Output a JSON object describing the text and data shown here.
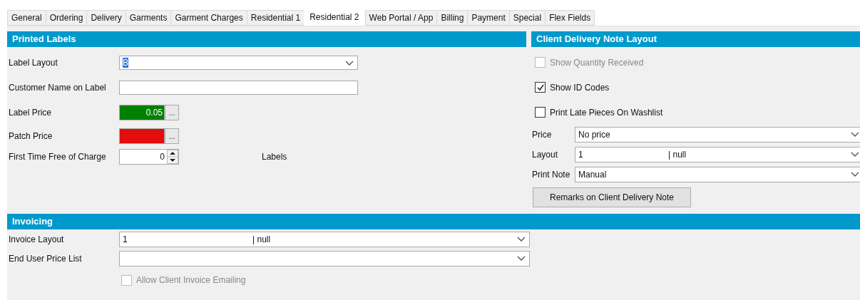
{
  "tabs": [
    {
      "label": "General",
      "selected": false
    },
    {
      "label": "Ordering",
      "selected": false
    },
    {
      "label": "Delivery",
      "selected": false
    },
    {
      "label": "Garments",
      "selected": false
    },
    {
      "label": "Garment Charges",
      "selected": false
    },
    {
      "label": "Residential 1",
      "selected": false
    },
    {
      "label": "Residential 2",
      "selected": true
    },
    {
      "label": "Web Portal / App",
      "selected": false
    },
    {
      "label": "Billing",
      "selected": false
    },
    {
      "label": "Payment",
      "selected": false
    },
    {
      "label": "Special",
      "selected": false
    },
    {
      "label": "Flex Fields",
      "selected": false
    }
  ],
  "printed_labels": {
    "title": "Printed Labels",
    "rows": [
      {
        "label": "Label Layout",
        "kind": "dropdown",
        "value": [
          "B"
        ],
        "highlighted": true
      },
      {
        "label": "Customer Name on Label",
        "kind": "text",
        "value": []
      },
      {
        "label": "Label Price",
        "kind": "price",
        "value": [
          "0.05"
        ],
        "color": "#008000",
        "button": "..."
      },
      {
        "label": "Patch Price",
        "kind": "price",
        "value": [],
        "color": "#e30d0d",
        "button": "..."
      },
      {
        "label": "First Time Free of Charge",
        "kind": "spinner",
        "value": [
          "0"
        ],
        "unit": "Labels"
      }
    ]
  },
  "client_delivery_note_layout": {
    "title": "Client Delivery Note Layout",
    "checkboxes": [
      {
        "label": "Show Quantity Received",
        "checked": false,
        "disabled": true
      },
      {
        "label": "Show ID Codes",
        "checked": true,
        "disabled": false
      },
      {
        "label": "Print Late Pieces On Washlist",
        "checked": false,
        "disabled": false
      }
    ],
    "rows": [
      {
        "label": "Price",
        "kind": "dropdown",
        "value": [
          "No price"
        ]
      },
      {
        "label": "Layout",
        "kind": "dropdown",
        "value": [
          "1",
          "| null"
        ]
      },
      {
        "label": "Print Note",
        "kind": "dropdown",
        "value": [
          "Manual"
        ]
      }
    ],
    "button": "Remarks on Client Delivery Note"
  },
  "invoicing": {
    "title": "Invoicing",
    "rows": [
      {
        "label": "Invoice Layout",
        "kind": "dropdown",
        "value": [
          "1",
          "| null"
        ]
      },
      {
        "label": "End User Price List",
        "kind": "dropdown",
        "value": []
      }
    ],
    "checkbox": {
      "label": "Allow Client Invoice Emailing",
      "checked": false,
      "disabled": true
    }
  }
}
